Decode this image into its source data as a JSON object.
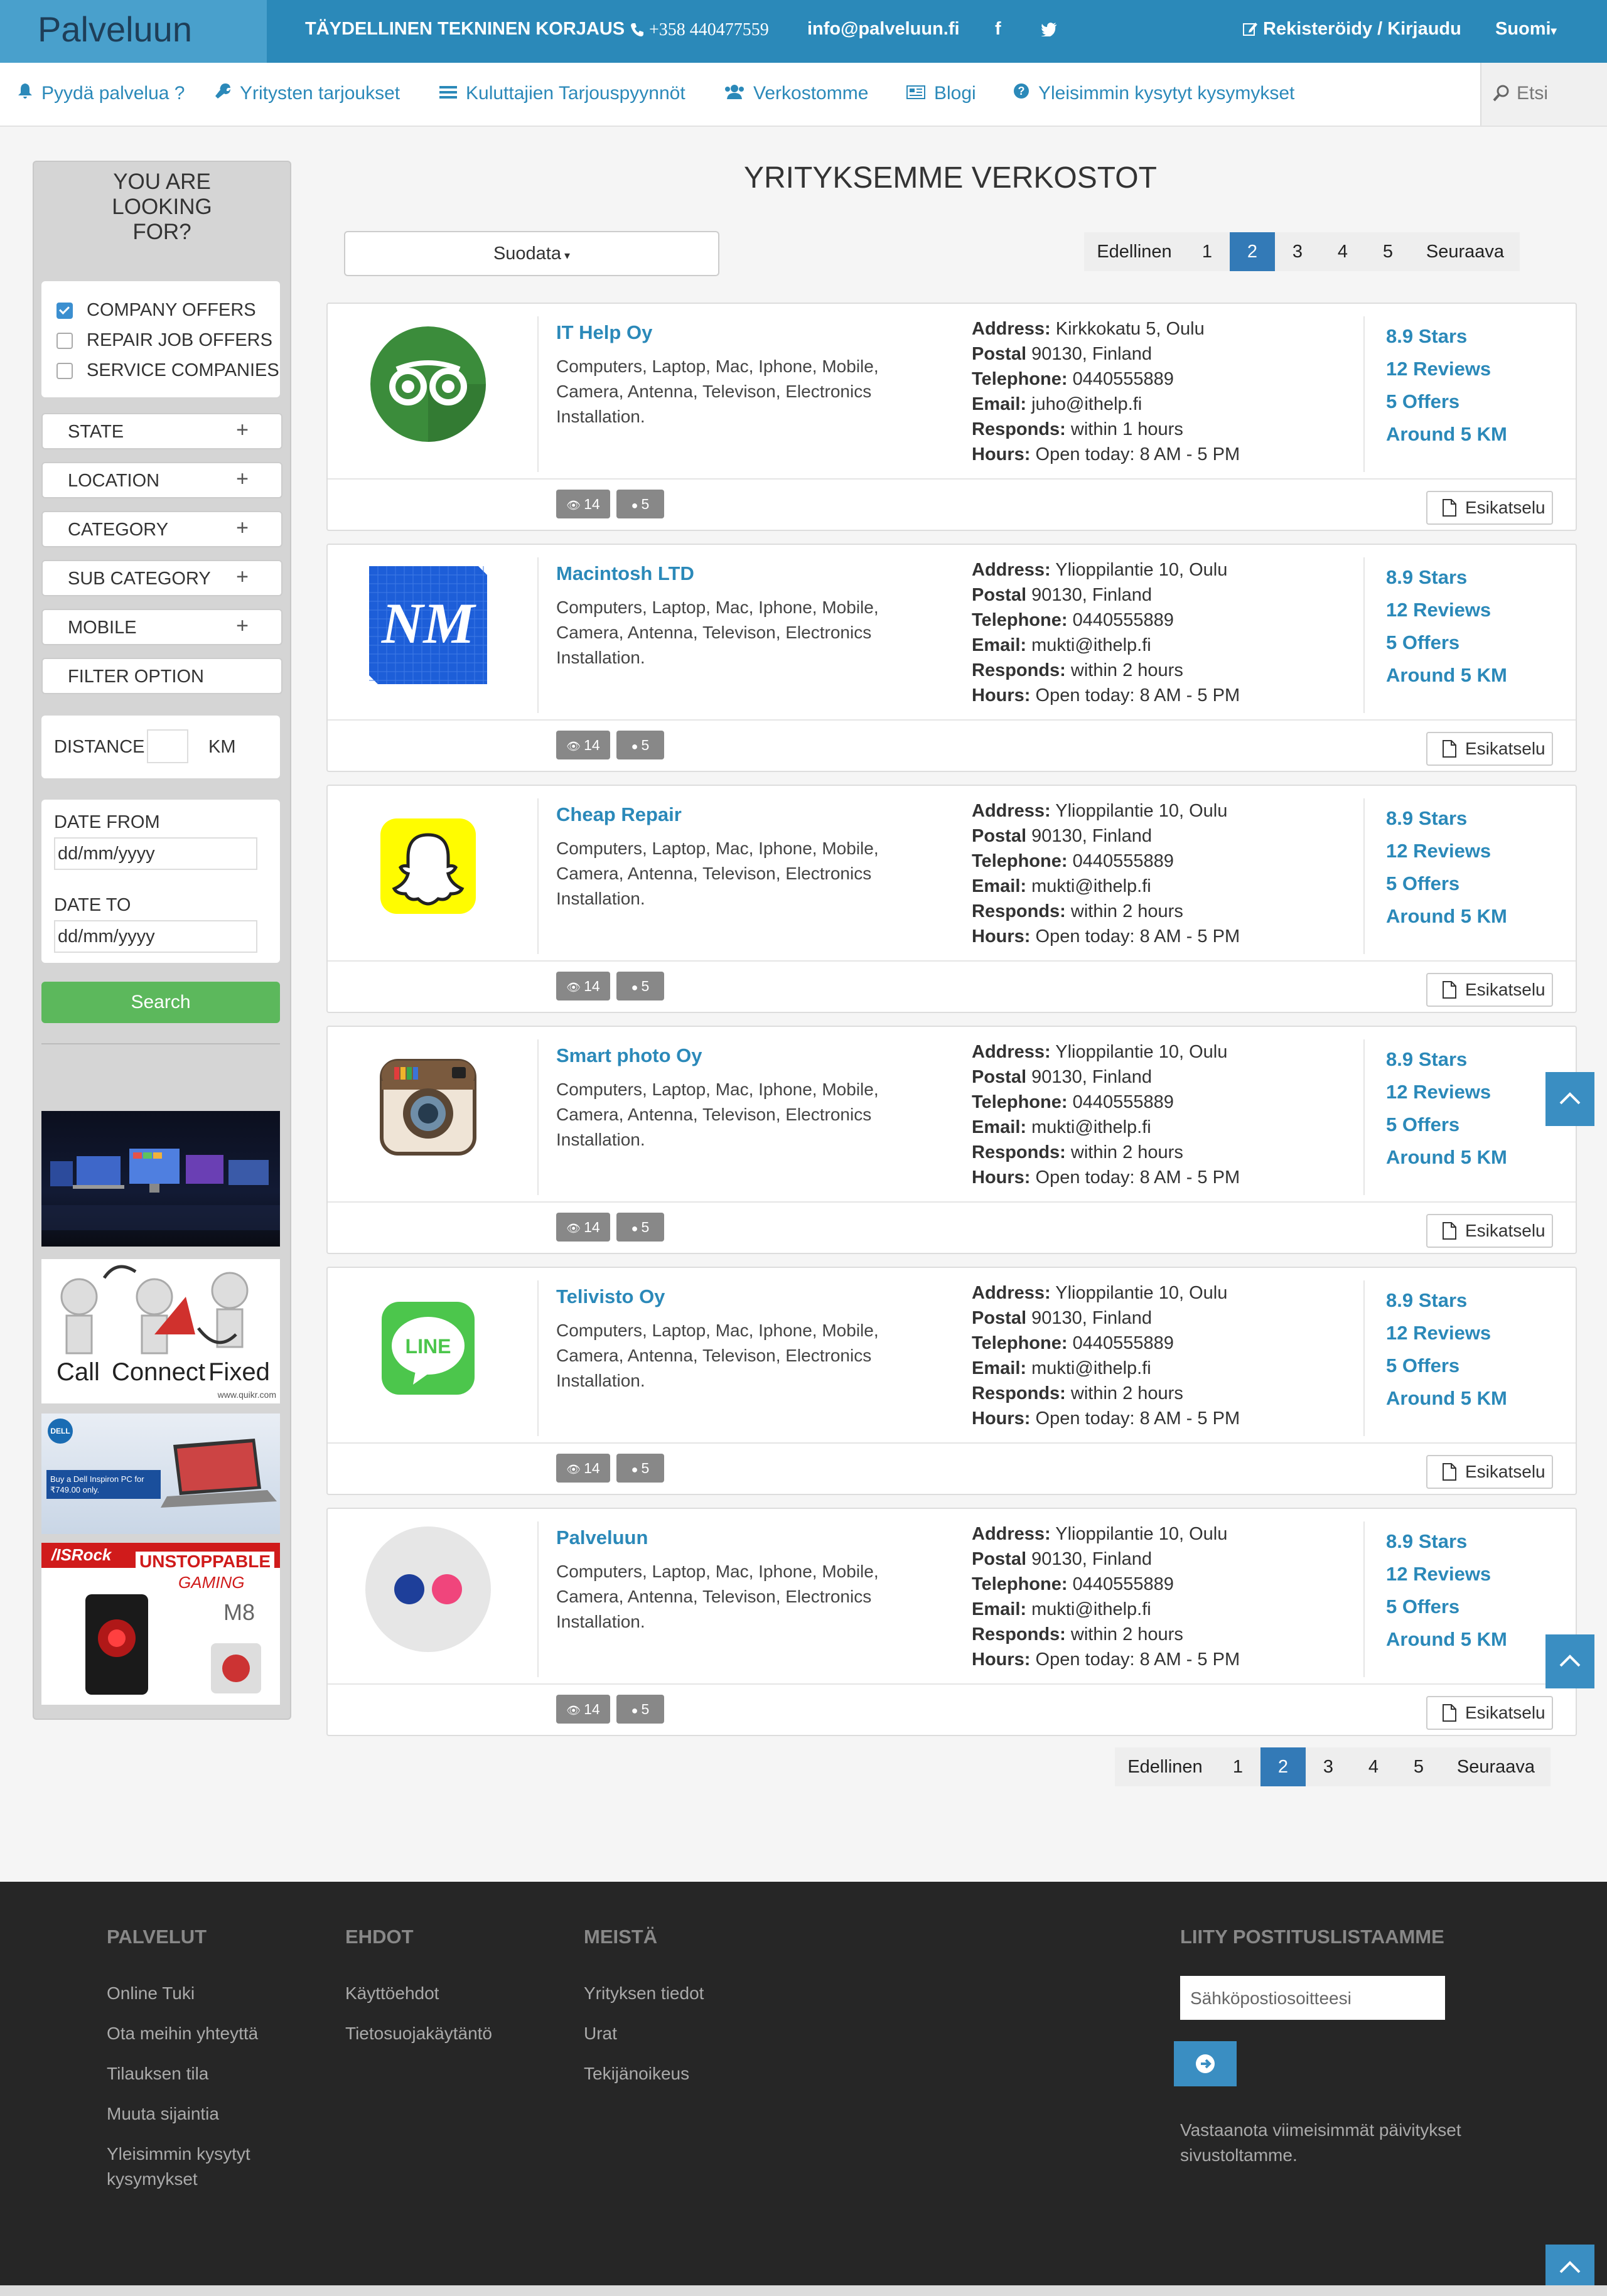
{
  "header": {
    "brand": "Palveluun",
    "tagline": "TÄYDELLINEN TEKNINEN KORJAUS",
    "phone": "+358 440477559",
    "email": "info@palveluun.fi",
    "facebook_icon": "f",
    "twitter_icon": "twitter-icon",
    "register": "Rekisteröidy / Kirjaudu",
    "language": "Suomi"
  },
  "nav": {
    "items": [
      {
        "label": "Pyydä palvelua ?",
        "icon": "bell-icon"
      },
      {
        "label": "Yritysten tarjoukset",
        "icon": "wrench-icon"
      },
      {
        "label": "Kuluttajien Tarjouspyynnöt",
        "icon": "list-icon"
      },
      {
        "label": "Verkostomme",
        "icon": "users-icon"
      },
      {
        "label": "Blogi",
        "icon": "blog-icon"
      },
      {
        "label": "Yleisimmin kysytyt kysymykset",
        "icon": "question-icon"
      }
    ],
    "search_placeholder": "Etsi"
  },
  "sidebar": {
    "title": "YOU ARE LOOKING FOR?",
    "checks": [
      {
        "label": "COMPANY OFFERS",
        "checked": true
      },
      {
        "label": "REPAIR JOB OFFERS",
        "checked": false
      },
      {
        "label": "SERVICE COMPANIES",
        "checked": false
      }
    ],
    "accordions": [
      "STATE",
      "LOCATION",
      "CATEGORY",
      "SUB CATEGORY",
      "MOBILE"
    ],
    "filter_option": "FILTER OPTION",
    "distance_label": "DISTANCE",
    "distance_unit": "KM",
    "date_from_label": "DATE FROM",
    "date_to_label": "DATE TO",
    "date_placeholder": "dd/mm/yyyy",
    "search_label": "Search",
    "ad_call": "Call",
    "ad_connect": "Connect",
    "ad_fixed": "Fixed",
    "ad_quikr": "www.quikr.com",
    "ad_dell": "DELL",
    "ad_dell_text": "Buy a Dell Inspiron PC for ₹749.00 only.",
    "ad_asrock": "/ISRock",
    "ad_unstoppable": "UNSTOPPABLE",
    "ad_gaming": "GAMING",
    "ad_m8": "M8"
  },
  "main": {
    "title": "YRITYKSEMME VERKOSTOT",
    "filter_label": "Suodata",
    "pagination": {
      "prev": "Edellinen",
      "pages": [
        "1",
        "2",
        "3",
        "4",
        "5"
      ],
      "active": "2",
      "next": "Seuraava"
    }
  },
  "labels": {
    "address": "Address:",
    "postal": "Postal",
    "telephone": "Telephone:",
    "email": "Email:",
    "responds": "Responds:",
    "hours": "Hours:",
    "preview": "Esikatselu"
  },
  "companies": [
    {
      "name": "IT Help Oy",
      "desc": "Computers, Laptop, Mac, Iphone, Mobile, Camera, Antenna, Televison, Electronics Installation.",
      "address": "Kirkkokatu 5, Oulu",
      "postal": "90130, Finland",
      "telephone": "0440555889",
      "email": "juho@ithelp.fi",
      "responds": "within 1 hours",
      "hours": "Open today: 8 AM - 5 PM",
      "stars": "8.9 Stars",
      "reviews": "12 Reviews",
      "offers": "5 Offers",
      "distance": "Around 5 KM",
      "views": "14",
      "users": "5",
      "logo": "tripadvisor-owl-logo"
    },
    {
      "name": "Macintosh LTD",
      "desc": "Computers, Laptop, Mac, Iphone, Mobile, Camera, Antenna, Televison, Electronics Installation.",
      "address": "Ylioppilantie 10, Oulu",
      "postal": "90130, Finland",
      "telephone": "0440555889",
      "email": "mukti@ithelp.fi",
      "responds": "within 2 hours",
      "hours": "Open today: 8 AM - 5 PM",
      "stars": "8.9 Stars",
      "reviews": "12 Reviews",
      "offers": "5 Offers",
      "distance": "Around 5 KM",
      "views": "14",
      "users": "5",
      "logo": "nm-logo",
      "logo_text": "NM"
    },
    {
      "name": "Cheap Repair",
      "desc": "Computers, Laptop, Mac, Iphone, Mobile, Camera, Antenna, Televison, Electronics Installation.",
      "address": "Ylioppilantie 10, Oulu",
      "postal": "90130, Finland",
      "telephone": "0440555889",
      "email": "mukti@ithelp.fi",
      "responds": "within 2 hours",
      "hours": "Open today: 8 AM - 5 PM",
      "stars": "8.9 Stars",
      "reviews": "12 Reviews",
      "offers": "5 Offers",
      "distance": "Around 5 KM",
      "views": "14",
      "users": "5",
      "logo": "snapchat-logo"
    },
    {
      "name": "Smart photo Oy",
      "desc": "Computers, Laptop, Mac, Iphone, Mobile, Camera, Antenna, Televison, Electronics Installation.",
      "address": "Ylioppilantie 10, Oulu",
      "postal": "90130, Finland",
      "telephone": "0440555889",
      "email": "mukti@ithelp.fi",
      "responds": "within 2 hours",
      "hours": "Open today: 8 AM - 5 PM",
      "stars": "8.9 Stars",
      "reviews": "12 Reviews",
      "offers": "5 Offers",
      "distance": "Around 5 KM",
      "views": "14",
      "users": "5",
      "logo": "instagram-camera-logo"
    },
    {
      "name": "Telivisto Oy",
      "desc": "Computers, Laptop, Mac, Iphone, Mobile, Camera, Antenna, Televison, Electronics Installation.",
      "address": "Ylioppilantie 10, Oulu",
      "postal": "90130, Finland",
      "telephone": "0440555889",
      "email": "mukti@ithelp.fi",
      "responds": "within 2 hours",
      "hours": "Open today: 8 AM - 5 PM",
      "stars": "8.9 Stars",
      "reviews": "12 Reviews",
      "offers": "5 Offers",
      "distance": "Around 5 KM",
      "views": "14",
      "users": "5",
      "logo": "line-logo",
      "logo_text": "LINE"
    },
    {
      "name": "Palveluun",
      "desc": "Computers, Laptop, Mac, Iphone, Mobile, Camera, Antenna, Televison, Electronics Installation.",
      "address": "Ylioppilantie 10, Oulu",
      "postal": "90130, Finland",
      "telephone": "0440555889",
      "email": "mukti@ithelp.fi",
      "responds": "within 2 hours",
      "hours": "Open today: 8 AM - 5 PM",
      "stars": "8.9 Stars",
      "reviews": "12 Reviews",
      "offers": "5 Offers",
      "distance": "Around 5 KM",
      "views": "14",
      "users": "5",
      "logo": "flickr-logo"
    }
  ],
  "footer": {
    "col1": {
      "title": "PALVELUT",
      "links": [
        "Online Tuki",
        "Ota meihin yhteyttä",
        "Tilauksen tila",
        "Muuta sijaintia",
        "Yleisimmin kysytyt kysymykset"
      ]
    },
    "col2": {
      "title": "EHDOT",
      "links": [
        "Käyttöehdot",
        "Tietosuojakäytäntö"
      ]
    },
    "col3": {
      "title": "MEISTÄ",
      "links": [
        "Yrityksen tiedot",
        "Urat",
        "Tekijänoikeus"
      ]
    },
    "newsletter": {
      "title": "LIITY POSTITUSLISTAAMME",
      "placeholder": "Sähköpostiosoitteesi",
      "note": "Vastaanota viimeisimmät päivitykset sivustoltamme."
    }
  },
  "colors": {
    "brand_blue": "#2b89b9",
    "active_page": "#337ab7",
    "search_green": "#5cb85c",
    "footer_bg": "#262626"
  }
}
